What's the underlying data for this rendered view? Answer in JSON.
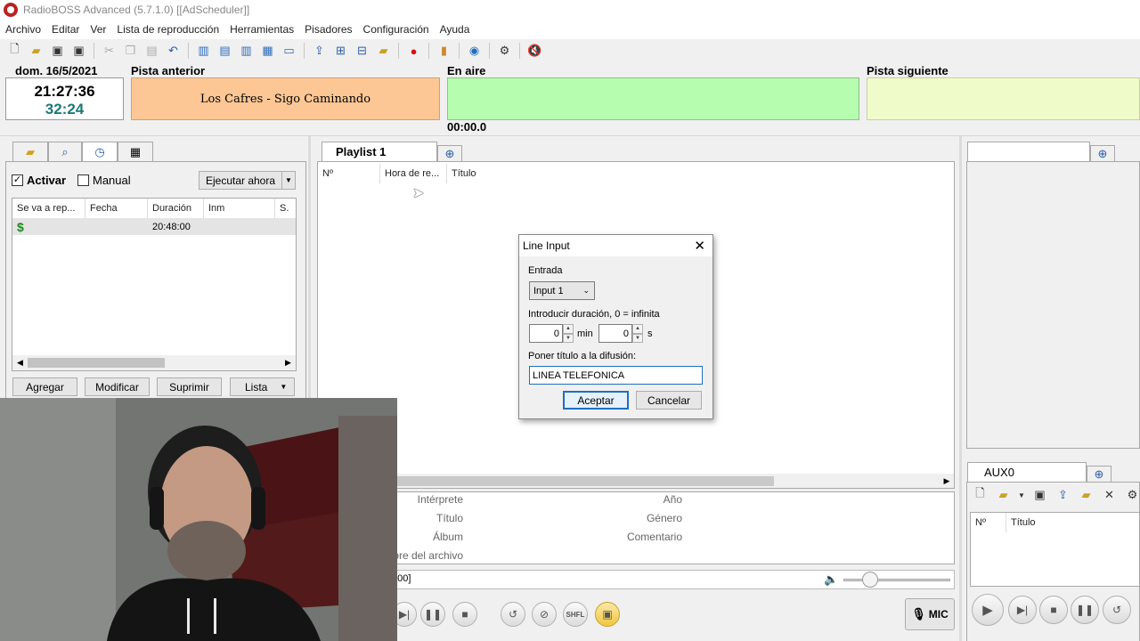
{
  "window": {
    "title": "RadioBOSS Advanced (5.7.1.0) [[AdScheduler]]"
  },
  "menu": [
    "Archivo",
    "Editar",
    "Ver",
    "Lista de reproducción",
    "Herramientas",
    "Pisadores",
    "Configuración",
    "Ayuda"
  ],
  "header": {
    "date": "dom. 16/5/2021",
    "time": "21:27:36",
    "remaining": "32:24",
    "prev_label": "Pista anterior",
    "prev_track": "Los Cafres - Sigo Caminando",
    "onair_label": "En aire",
    "onair_time": "00:00.0",
    "next_label": "Pista siguiente"
  },
  "scheduler": {
    "activate_label": "Activar",
    "manual_label": "Manual",
    "run_now_label": "Ejecutar ahora",
    "columns": [
      "Se va a rep...",
      "Fecha",
      "Duración",
      "Inm",
      "S."
    ],
    "rows": [
      {
        "icon": "$",
        "play": "",
        "date": "",
        "duration": "20:48:00",
        "inm": "",
        "s": ""
      }
    ],
    "buttons": {
      "add": "Agregar",
      "modify": "Modificar",
      "delete": "Suprimir",
      "list": "Lista"
    }
  },
  "playlist": {
    "tab": "Playlist 1",
    "columns": [
      "Nº",
      "Hora de re...",
      "Título"
    ]
  },
  "trackinfo": {
    "artist": "Intérprete",
    "title": "Título",
    "album": "Álbum",
    "filename": "mbre del archivo",
    "year": "Año",
    "genre": "Género",
    "comment": "Comentario",
    "position": "0:00]"
  },
  "mic_label": "MIC",
  "shfl_label": "SHFL",
  "aux": {
    "tab": "AUX0",
    "columns": [
      "Nº",
      "Título"
    ]
  },
  "dialog": {
    "title": "Line Input",
    "input_label": "Entrada",
    "input_value": "Input 1",
    "duration_label": "Introducir duración, 0 = infinita",
    "min_value": "0",
    "min_unit": "min",
    "sec_value": "0",
    "sec_unit": "s",
    "broadcast_label": "Poner título a la difusión:",
    "broadcast_value": "LINEA TELEFONICA",
    "ok": "Aceptar",
    "cancel": "Cancelar"
  },
  "colors": {
    "prev": "#fcc794",
    "onair": "#b6fdb0",
    "next": "#effcc9",
    "remaining": "#1a7a74"
  }
}
